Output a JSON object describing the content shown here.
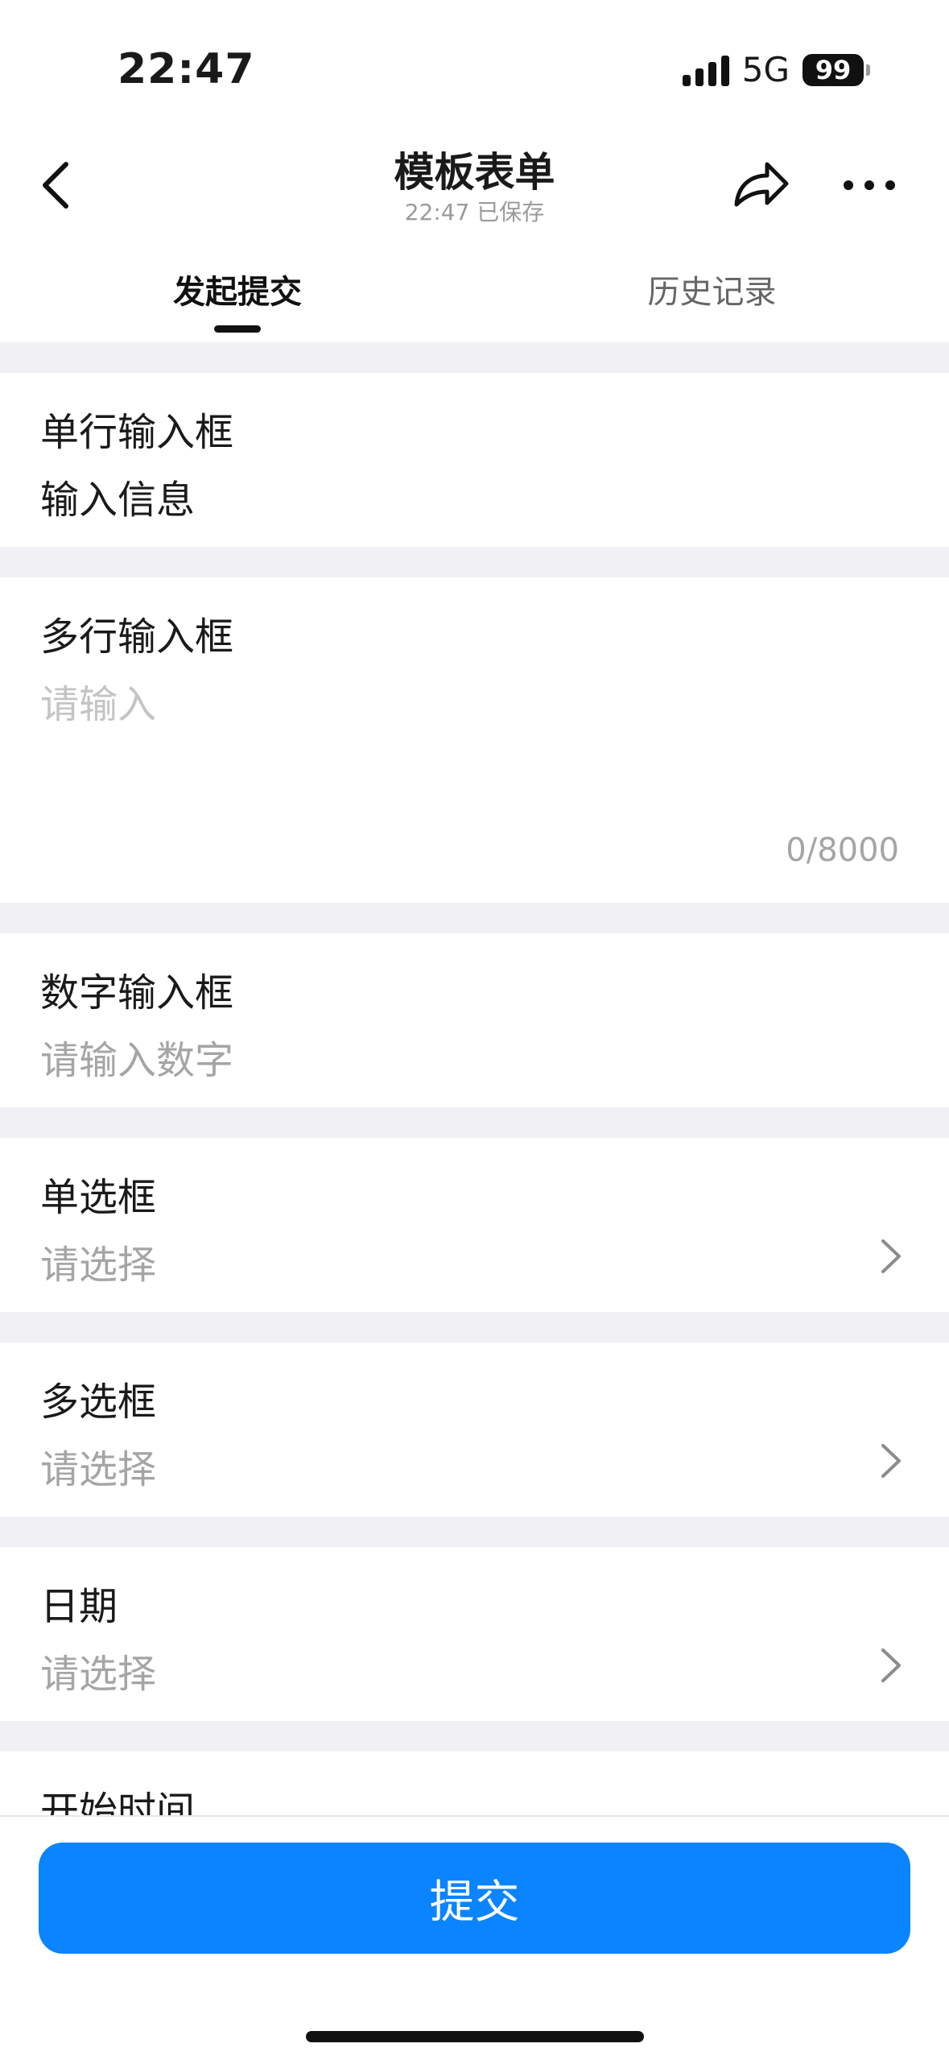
{
  "status_bar": {
    "time": "22:47",
    "network": "5G",
    "battery": "99"
  },
  "nav": {
    "title": "模板表单",
    "subtitle": "22:47 已保存"
  },
  "tabs": [
    {
      "label": "发起提交",
      "active": true
    },
    {
      "label": "历史记录",
      "active": false
    }
  ],
  "form": {
    "single_line": {
      "label": "单行输入框",
      "value": "输入信息"
    },
    "multi_line": {
      "label": "多行输入框",
      "placeholder": "请输入",
      "counter": "0/8000"
    },
    "number": {
      "label": "数字输入框",
      "placeholder": "请输入数字"
    },
    "radio": {
      "label": "单选框",
      "placeholder": "请选择"
    },
    "checkbox": {
      "label": "多选框",
      "placeholder": "请选择"
    },
    "date": {
      "label": "日期",
      "placeholder": "请选择"
    },
    "start_time": {
      "label": "开始时间"
    }
  },
  "submit_label": "提交",
  "colors": {
    "accent": "#0a84ff",
    "background_gap": "#f1f1f5",
    "placeholder": "#a5a5a5"
  }
}
